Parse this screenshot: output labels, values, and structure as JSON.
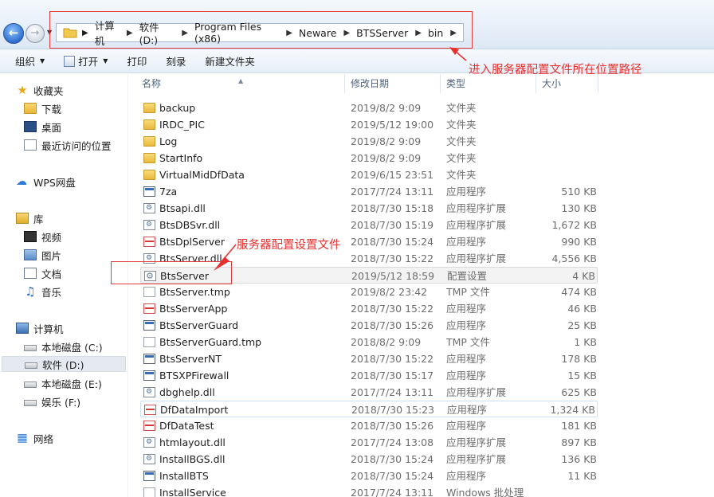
{
  "address_bar": {
    "breadcrumbs": [
      "计算机",
      "软件 (D:)",
      "Program Files (x86)",
      "Neware",
      "BTSServer",
      "bin"
    ]
  },
  "toolbar": {
    "organize": "组织",
    "open": "打开",
    "print": "打印",
    "burn": "刻录",
    "new_folder": "新建文件夹"
  },
  "nav_pane": {
    "favorites": "收藏夹",
    "downloads": "下载",
    "desktop": "桌面",
    "recent": "最近访问的位置",
    "wps_cloud": "WPS网盘",
    "libraries": "库",
    "videos": "视频",
    "pictures": "图片",
    "documents": "文档",
    "music": "音乐",
    "computer": "计算机",
    "drive_c": "本地磁盘 (C:)",
    "drive_d": "软件 (D:)",
    "drive_e": "本地磁盘 (E:)",
    "drive_f": "娱乐 (F:)",
    "network": "网络"
  },
  "columns": {
    "name": "名称",
    "modified": "修改日期",
    "type": "类型",
    "size": "大小"
  },
  "files": [
    {
      "name": "backup",
      "date": "2019/8/2 9:09",
      "type": "文件夹",
      "size": "",
      "icon": "folder-icon"
    },
    {
      "name": "IRDC_PIC",
      "date": "2019/5/12 19:00",
      "type": "文件夹",
      "size": "",
      "icon": "folder-icon"
    },
    {
      "name": "Log",
      "date": "2019/8/2 9:09",
      "type": "文件夹",
      "size": "",
      "icon": "folder-icon"
    },
    {
      "name": "StartInfo",
      "date": "2019/8/2 9:09",
      "type": "文件夹",
      "size": "",
      "icon": "folder-icon"
    },
    {
      "name": "VirtualMidDfData",
      "date": "2019/6/15 23:51",
      "type": "文件夹",
      "size": "",
      "icon": "folder-icon"
    },
    {
      "name": "7za",
      "date": "2017/7/24 13:11",
      "type": "应用程序",
      "size": "510 KB",
      "icon": "exe-icon"
    },
    {
      "name": "Btsapi.dll",
      "date": "2018/7/30 15:18",
      "type": "应用程序扩展",
      "size": "130 KB",
      "icon": "dll-icon"
    },
    {
      "name": "BtsDBSvr.dll",
      "date": "2018/7/30 15:19",
      "type": "应用程序扩展",
      "size": "1,672 KB",
      "icon": "dll-icon"
    },
    {
      "name": "BtsDplServer",
      "date": "2018/7/30 15:24",
      "type": "应用程序",
      "size": "990 KB",
      "icon": "app-red-icon"
    },
    {
      "name": "BtsServer.dll",
      "date": "2018/7/30 15:22",
      "type": "应用程序扩展",
      "size": "4,556 KB",
      "icon": "dll-icon"
    },
    {
      "name": "BtsServer",
      "date": "2019/5/12 18:59",
      "type": "配置设置",
      "size": "4 KB",
      "icon": "config-icon"
    },
    {
      "name": "BtsServer.tmp",
      "date": "2019/8/2 23:42",
      "type": "TMP 文件",
      "size": "474 KB",
      "icon": "file-icon"
    },
    {
      "name": "BtsServerApp",
      "date": "2018/7/30 15:22",
      "type": "应用程序",
      "size": "46 KB",
      "icon": "app-red-icon"
    },
    {
      "name": "BtsServerGuard",
      "date": "2018/7/30 15:26",
      "type": "应用程序",
      "size": "25 KB",
      "icon": "exe-icon"
    },
    {
      "name": "BtsServerGuard.tmp",
      "date": "2018/8/2 9:09",
      "type": "TMP 文件",
      "size": "1 KB",
      "icon": "file-icon"
    },
    {
      "name": "BtsServerNT",
      "date": "2018/7/30 15:22",
      "type": "应用程序",
      "size": "178 KB",
      "icon": "exe-icon"
    },
    {
      "name": "BTSXPFirewall",
      "date": "2018/7/30 15:17",
      "type": "应用程序",
      "size": "15 KB",
      "icon": "exe-icon"
    },
    {
      "name": "dbghelp.dll",
      "date": "2017/7/24 13:11",
      "type": "应用程序扩展",
      "size": "625 KB",
      "icon": "dll-icon"
    },
    {
      "name": "DfDataImport",
      "date": "2018/7/30 15:23",
      "type": "应用程序",
      "size": "1,324 KB",
      "icon": "app-red-icon"
    },
    {
      "name": "DfDataTest",
      "date": "2018/7/30 15:26",
      "type": "应用程序",
      "size": "181 KB",
      "icon": "app-red-icon"
    },
    {
      "name": "htmlayout.dll",
      "date": "2017/7/24 13:08",
      "type": "应用程序扩展",
      "size": "897 KB",
      "icon": "dll-icon"
    },
    {
      "name": "InstallBGS.dll",
      "date": "2018/7/30 15:24",
      "type": "应用程序扩展",
      "size": "136 KB",
      "icon": "dll-icon"
    },
    {
      "name": "InstallBTS",
      "date": "2018/7/30 15:24",
      "type": "应用程序",
      "size": "11 KB",
      "icon": "exe-icon"
    },
    {
      "name": "InstallService",
      "date": "2017/7/24 13:11",
      "type": "Windows 批处理",
      "size": "",
      "icon": "file-icon"
    }
  ],
  "annotations": {
    "path_note": "进入服务器配置文件所在位置路径",
    "file_note": "服务器配置设置文件",
    "color": "#e8312f"
  }
}
